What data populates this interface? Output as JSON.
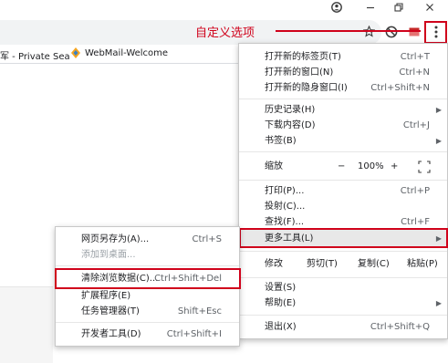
{
  "toolbar": {
    "account_icon": "account-circle-icon",
    "minimize_icon": "minimize-icon",
    "restore_icon": "restore-icon",
    "close_icon": "close-icon",
    "star_icon": "star-icon",
    "extension_icon": "extension-icon",
    "menu_icon": "three-dot-menu-icon"
  },
  "annotation": {
    "label": "自定义选项",
    "color": "#d0021b"
  },
  "bookmarks": {
    "private_search": "军 - Private Sea",
    "webmail": "WebMail-Welcome"
  },
  "main_menu": {
    "new_tab": {
      "label": "打开新的标签页(T)",
      "shortcut": "Ctrl+T"
    },
    "new_window": {
      "label": "打开新的窗口(N)",
      "shortcut": "Ctrl+N"
    },
    "incognito": {
      "label": "打开新的隐身窗口(I)",
      "shortcut": "Ctrl+Shift+N"
    },
    "history": {
      "label": "历史记录(H)"
    },
    "downloads": {
      "label": "下载内容(D)",
      "shortcut": "Ctrl+J"
    },
    "bookmarks": {
      "label": "书签(B)"
    },
    "zoom": {
      "label": "缩放",
      "minus": "−",
      "value": "100%",
      "plus": "+"
    },
    "print": {
      "label": "打印(P)...",
      "shortcut": "Ctrl+P"
    },
    "cast": {
      "label": "投射(C)..."
    },
    "find": {
      "label": "查找(F)...",
      "shortcut": "Ctrl+F"
    },
    "more_tools": {
      "label": "更多工具(L)"
    },
    "edit": {
      "label": "修改",
      "cut": "剪切(T)",
      "copy": "复制(C)",
      "paste": "粘贴(P)"
    },
    "settings": {
      "label": "设置(S)"
    },
    "help": {
      "label": "帮助(E)"
    },
    "exit": {
      "label": "退出(X)",
      "shortcut": "Ctrl+Shift+Q"
    }
  },
  "submenu": {
    "save_page": {
      "label": "网页另存为(A)...",
      "shortcut": "Ctrl+S"
    },
    "add_desktop": {
      "label": "添加到桌面..."
    },
    "clear_data": {
      "label": "清除浏览数据(C)...",
      "shortcut": "Ctrl+Shift+Del"
    },
    "extensions": {
      "label": "扩展程序(E)"
    },
    "task_manager": {
      "label": "任务管理器(T)",
      "shortcut": "Shift+Esc"
    },
    "dev_tools": {
      "label": "开发者工具(D)",
      "shortcut": "Ctrl+Shift+I"
    }
  }
}
